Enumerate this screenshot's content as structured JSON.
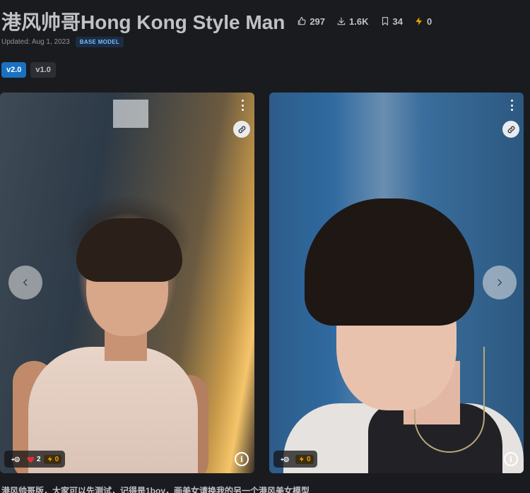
{
  "model": {
    "title": "港风帅哥Hong Kong Style Man",
    "stats": {
      "likes": "297",
      "downloads": "1.6K",
      "bookmarks": "34",
      "buzz": "0"
    },
    "updated": "Updated: Aug 1, 2023",
    "badge": "BASE MODEL"
  },
  "versions": [
    {
      "label": "v2.0",
      "active": true
    },
    {
      "label": "v1.0",
      "active": false
    }
  ],
  "gallery": {
    "cards": [
      {
        "reaction_count": "2",
        "buzz": "0",
        "info": "i"
      },
      {
        "buzz": "0",
        "info": "i"
      }
    ]
  },
  "description": "港风帅哥版，大家可以先测试，记得是1boy，画美女请换我的另一个港风美女模型",
  "icons": {
    "likes": "thumbs-up-icon",
    "downloads": "download-icon",
    "bookmarks": "bookmark-icon",
    "buzz": "lightning-icon",
    "link": "link-icon",
    "menu": "dots-vertical-icon",
    "prev": "chevron-left-icon",
    "next": "chevron-right-icon",
    "add_reaction": "plus-smile-icon",
    "heart": "heart-icon",
    "info": "info-icon"
  },
  "colors": {
    "background": "#1a1b1e",
    "accent": "#1971c2",
    "buzz": "#f59f00",
    "heart": "#e03131"
  }
}
